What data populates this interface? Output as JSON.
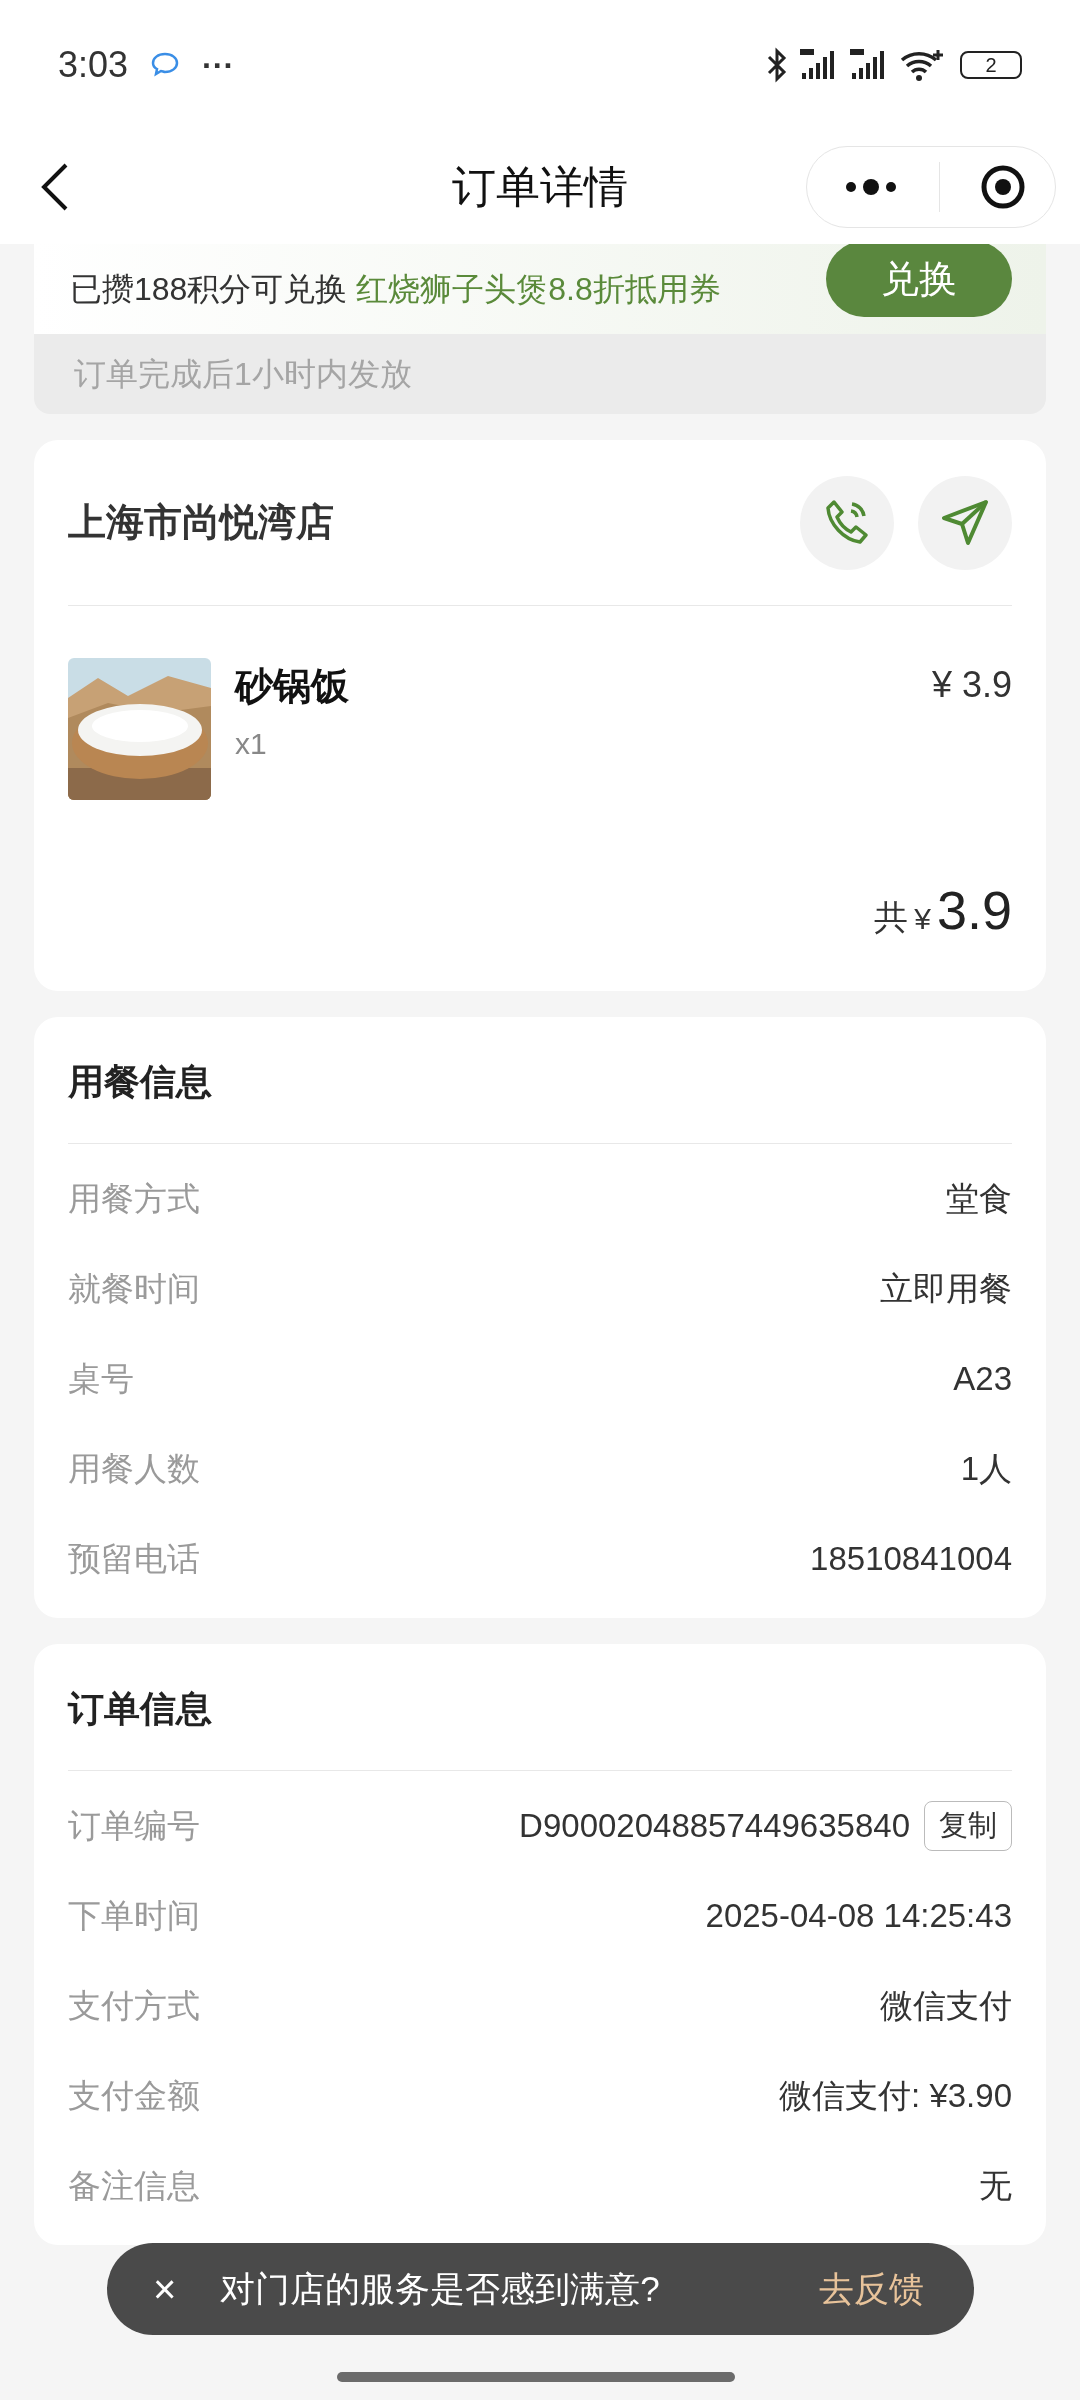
{
  "status_bar": {
    "time": "3:03",
    "more": "···",
    "battery": "2"
  },
  "header": {
    "title": "订单详情"
  },
  "points_banner": {
    "text": "已攒188积分可兑换",
    "reward": "红烧狮子头煲8.8折抵用券",
    "button": "兑换",
    "note": "订单完成后1小时内发放"
  },
  "store": {
    "name": "上海市尚悦湾店",
    "items": [
      {
        "kind": "picture",
        "name": "砂锅饭",
        "quantity": "x1",
        "price": "¥ 3.9"
      }
    ],
    "total_label": "共",
    "total_currency": "¥",
    "total": "3.9"
  },
  "dining_info": {
    "title": "用餐信息",
    "rows": [
      {
        "label": "用餐方式",
        "value": "堂食"
      },
      {
        "label": "就餐时间",
        "value": "立即用餐"
      },
      {
        "label": "桌号",
        "value": "A23"
      },
      {
        "label": "用餐人数",
        "value": "1人"
      },
      {
        "label": "预留电话",
        "value": "18510841004"
      }
    ]
  },
  "order_info": {
    "title": "订单信息",
    "rows": [
      {
        "label": "订单编号",
        "value": "D90002048857449635840",
        "action": "复制"
      },
      {
        "label": "下单时间",
        "value": "2025-04-08 14:25:43"
      },
      {
        "label": "支付方式",
        "value": "微信支付"
      },
      {
        "label": "支付金额",
        "value": "微信支付: ¥3.90"
      },
      {
        "label": "备注信息",
        "value": "无"
      }
    ]
  },
  "feedback_toast": {
    "close": "×",
    "text": "对门店的服务是否感到满意?",
    "action": "去反馈"
  }
}
